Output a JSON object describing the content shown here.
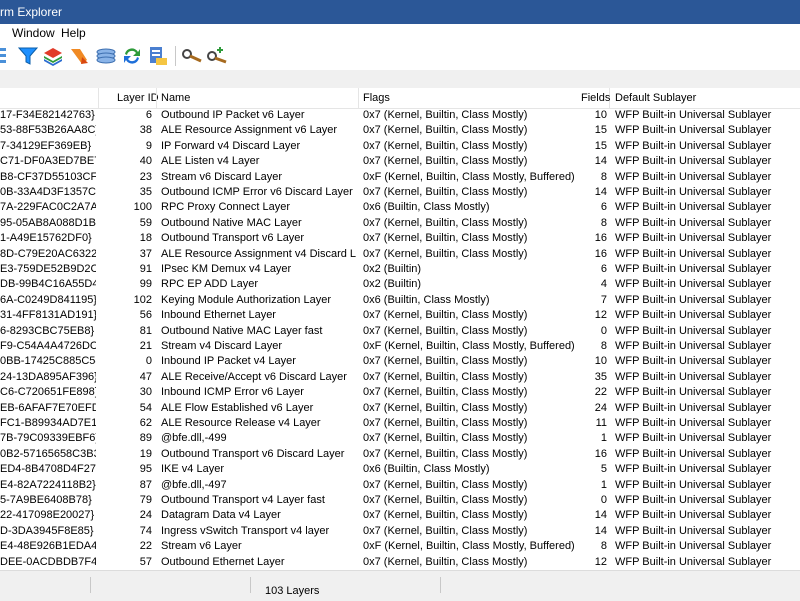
{
  "window": {
    "title": "rm Explorer"
  },
  "menu": {
    "window": "Window",
    "help": "Help"
  },
  "toolbar": {
    "icons": [
      "tree-icon",
      "filter-icon",
      "layers-icon",
      "arrow-icon",
      "sublayers-icon",
      "refresh-icon",
      "export-icon",
      "key-search-icon",
      "key-add-icon"
    ]
  },
  "table": {
    "headers": {
      "key": "",
      "layer_id": "Layer ID",
      "name": "Name",
      "flags": "Flags",
      "fields": "Fields",
      "default_sublayer": "Default Sublayer"
    },
    "rows": [
      {
        "key": "17-F34E82142763}",
        "id": "6",
        "name": "Outbound IP Packet v6 Layer",
        "flags": "0x7 (Kernel, Builtin, Class Mostly)",
        "fields": "10",
        "sub": "WFP Built-in Universal Sublayer"
      },
      {
        "key": "53-88F53B26AA8C}",
        "id": "38",
        "name": "ALE Resource Assignment v6 Layer",
        "flags": "0x7 (Kernel, Builtin, Class Mostly)",
        "fields": "15",
        "sub": "WFP Built-in Universal Sublayer"
      },
      {
        "key": "7-34129EF369EB}",
        "id": "9",
        "name": "IP Forward v4 Discard Layer",
        "flags": "0x7 (Kernel, Builtin, Class Mostly)",
        "fields": "15",
        "sub": "WFP Built-in Universal Sublayer"
      },
      {
        "key": "C71-DF0A3ED7BE7E}",
        "id": "40",
        "name": "ALE Listen v4 Layer",
        "flags": "0x7 (Kernel, Builtin, Class Mostly)",
        "fields": "14",
        "sub": "WFP Built-in Universal Sublayer"
      },
      {
        "key": "B8-CF37D55103CF}",
        "id": "23",
        "name": "Stream v6 Discard Layer",
        "flags": "0xF (Kernel, Builtin, Class Mostly, Buffered)",
        "fields": "8",
        "sub": "WFP Built-in Universal Sublayer"
      },
      {
        "key": "0B-33A4D3F1357C}",
        "id": "35",
        "name": "Outbound ICMP Error v6 Discard Layer",
        "flags": "0x7 (Kernel, Builtin, Class Mostly)",
        "fields": "14",
        "sub": "WFP Built-in Universal Sublayer"
      },
      {
        "key": "7A-229FAC0C2A7A}",
        "id": "100",
        "name": "RPC Proxy Connect Layer",
        "flags": "0x6 (Builtin, Class Mostly)",
        "fields": "6",
        "sub": "WFP Built-in Universal Sublayer"
      },
      {
        "key": "95-05AB8A088D1B}",
        "id": "59",
        "name": "Outbound Native MAC Layer",
        "flags": "0x7 (Kernel, Builtin, Class Mostly)",
        "fields": "8",
        "sub": "WFP Built-in Universal Sublayer"
      },
      {
        "key": "1-A49E15762DF0}",
        "id": "18",
        "name": "Outbound Transport v6 Layer",
        "flags": "0x7 (Kernel, Builtin, Class Mostly)",
        "fields": "16",
        "sub": "WFP Built-in Universal Sublayer"
      },
      {
        "key": "8D-C79E20AC6322}",
        "id": "37",
        "name": "ALE Resource Assignment v4 Discard Layer",
        "flags": "0x7 (Kernel, Builtin, Class Mostly)",
        "fields": "16",
        "sub": "WFP Built-in Universal Sublayer"
      },
      {
        "key": "E3-759DE52B9D2C}",
        "id": "91",
        "name": "IPsec KM Demux v4 Layer",
        "flags": "0x2 (Builtin)",
        "fields": "6",
        "sub": "WFP Built-in Universal Sublayer"
      },
      {
        "key": "DB-99B4C16A55D4}",
        "id": "99",
        "name": "RPC EP ADD Layer",
        "flags": "0x2 (Builtin)",
        "fields": "4",
        "sub": "WFP Built-in Universal Sublayer"
      },
      {
        "key": "6A-C0249D841195}",
        "id": "102",
        "name": "Keying Module Authorization Layer",
        "flags": "0x6 (Builtin, Class Mostly)",
        "fields": "7",
        "sub": "WFP Built-in Universal Sublayer"
      },
      {
        "key": "31-4FF8131AD191}",
        "id": "56",
        "name": "Inbound Ethernet Layer",
        "flags": "0x7 (Kernel, Builtin, Class Mostly)",
        "fields": "12",
        "sub": "WFP Built-in Universal Sublayer"
      },
      {
        "key": "6-8293CBC75EB8}",
        "id": "81",
        "name": "Outbound Native MAC Layer fast",
        "flags": "0x7 (Kernel, Builtin, Class Mostly)",
        "fields": "0",
        "sub": "WFP Built-in Universal Sublayer"
      },
      {
        "key": "F9-C54A4A4726DC}",
        "id": "21",
        "name": "Stream v4 Discard Layer",
        "flags": "0xF (Kernel, Builtin, Class Mostly, Buffered)",
        "fields": "8",
        "sub": "WFP Built-in Universal Sublayer"
      },
      {
        "key": "0BB-17425C885C58}",
        "id": "0",
        "name": "Inbound IP Packet v4 Layer",
        "flags": "0x7 (Kernel, Builtin, Class Mostly)",
        "fields": "10",
        "sub": "WFP Built-in Universal Sublayer"
      },
      {
        "key": "24-13DA895AF396}",
        "id": "47",
        "name": "ALE Receive/Accept v6 Discard Layer",
        "flags": "0x7 (Kernel, Builtin, Class Mostly)",
        "fields": "35",
        "sub": "WFP Built-in Universal Sublayer"
      },
      {
        "key": "C6-C720651FE898}",
        "id": "30",
        "name": "Inbound ICMP Error v6 Layer",
        "flags": "0x7 (Kernel, Builtin, Class Mostly)",
        "fields": "22",
        "sub": "WFP Built-in Universal Sublayer"
      },
      {
        "key": "EB-6AFAF7E70EFD}",
        "id": "54",
        "name": "ALE Flow Established v6 Layer",
        "flags": "0x7 (Kernel, Builtin, Class Mostly)",
        "fields": "24",
        "sub": "WFP Built-in Universal Sublayer"
      },
      {
        "key": "FC1-B89934AD7E15}",
        "id": "62",
        "name": "ALE Resource Release v4 Layer",
        "flags": "0x7 (Kernel, Builtin, Class Mostly)",
        "fields": "11",
        "sub": "WFP Built-in Universal Sublayer"
      },
      {
        "key": "7B-79C09339EBF6}",
        "id": "89",
        "name": "@bfe.dll,-499",
        "flags": "0x7 (Kernel, Builtin, Class Mostly)",
        "fields": "1",
        "sub": "WFP Built-in Universal Sublayer"
      },
      {
        "key": "0B2-57165658C3B3}",
        "id": "19",
        "name": "Outbound Transport v6 Discard Layer",
        "flags": "0x7 (Kernel, Builtin, Class Mostly)",
        "fields": "16",
        "sub": "WFP Built-in Universal Sublayer"
      },
      {
        "key": "ED4-8B4708D4F270}",
        "id": "95",
        "name": "IKE v4 Layer",
        "flags": "0x6 (Builtin, Class Mostly)",
        "fields": "5",
        "sub": "WFP Built-in Universal Sublayer"
      },
      {
        "key": "E4-82A7224118B2}",
        "id": "87",
        "name": "@bfe.dll,-497",
        "flags": "0x7 (Kernel, Builtin, Class Mostly)",
        "fields": "1",
        "sub": "WFP Built-in Universal Sublayer"
      },
      {
        "key": "5-7A9BE6408B78}",
        "id": "79",
        "name": "Outbound Transport v4 Layer fast",
        "flags": "0x7 (Kernel, Builtin, Class Mostly)",
        "fields": "0",
        "sub": "WFP Built-in Universal Sublayer"
      },
      {
        "key": "22-417098E20027}",
        "id": "24",
        "name": "Datagram Data v4 Layer",
        "flags": "0x7 (Kernel, Builtin, Class Mostly)",
        "fields": "14",
        "sub": "WFP Built-in Universal Sublayer"
      },
      {
        "key": "D-3DA3945F8E85}",
        "id": "74",
        "name": "Ingress vSwitch Transport v4 layer",
        "flags": "0x7 (Kernel, Builtin, Class Mostly)",
        "fields": "14",
        "sub": "WFP Built-in Universal Sublayer"
      },
      {
        "key": "E4-48E926B1EDA4}",
        "id": "22",
        "name": "Stream v6 Layer",
        "flags": "0xF (Kernel, Builtin, Class Mostly, Buffered)",
        "fields": "8",
        "sub": "WFP Built-in Universal Sublayer"
      },
      {
        "key": "DEE-0ACDBDB7F4B2}",
        "id": "57",
        "name": "Outbound Ethernet Layer",
        "flags": "0x7 (Kernel, Builtin, Class Mostly)",
        "fields": "12",
        "sub": "WFP Built-in Universal Sublayer"
      }
    ]
  },
  "status": {
    "count": "103 Layers"
  }
}
